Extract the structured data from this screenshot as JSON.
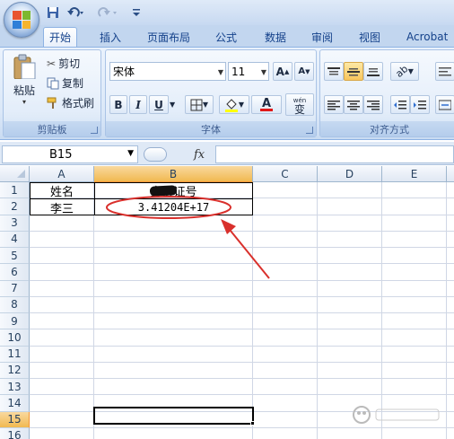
{
  "quick_access": {
    "save_icon": "save-icon",
    "undo_icon": "undo-icon",
    "redo_icon": "redo-icon",
    "customize_icon": "customize-icon"
  },
  "tabs": [
    "开始",
    "插入",
    "页面布局",
    "公式",
    "数据",
    "审阅",
    "视图",
    "Acrobat"
  ],
  "active_tab": "开始",
  "clipboard": {
    "paste_label": "粘贴",
    "cut_label": "剪切",
    "copy_label": "复制",
    "format_painter_label": "格式刷",
    "group_label": "剪贴板"
  },
  "font": {
    "font_name": "宋体",
    "font_size": "11",
    "bold": "B",
    "italic": "I",
    "underline": "U",
    "font_color_letter": "A",
    "wen_label": "wén",
    "wen_char": "变",
    "grow_label": "A",
    "shrink_label": "A",
    "group_label": "字体"
  },
  "alignment": {
    "group_label": "对齐方式"
  },
  "formula_bar": {
    "name_box": "B15",
    "fx_label": "fx",
    "formula": ""
  },
  "columns": [
    "A",
    "B",
    "C",
    "D",
    "E"
  ],
  "selected_column": "B",
  "rows": [
    "1",
    "2",
    "3",
    "4",
    "5",
    "6",
    "7",
    "8",
    "9",
    "10",
    "11",
    "12",
    "13",
    "14",
    "15",
    "16"
  ],
  "selected_row": "15",
  "cells": {
    "A1": "姓名",
    "B1": "身份证号",
    "A2": "李三",
    "B2": "3.41204E+17"
  },
  "colors": {
    "ribbon_blue": "#dbe8f8",
    "selection_orange": "#f1b951",
    "annotation_red": "#d9302c"
  }
}
